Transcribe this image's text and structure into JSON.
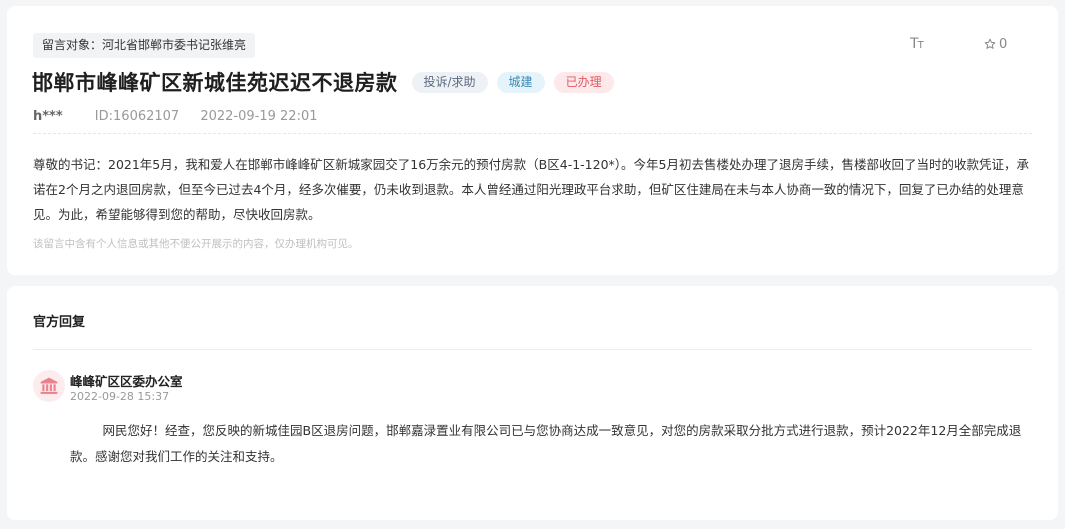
{
  "message": {
    "target_label": "留言对象：河北省邯郸市委书记张维亮",
    "title": "邯郸市峰峰矿区新城佳苑迟迟不退房款",
    "tags": {
      "type": "投诉/求助",
      "category": "城建",
      "status": "已办理"
    },
    "user": "h***",
    "id_label": "ID:16062107",
    "datetime": "2022-09-19 22:01",
    "content": "尊敬的书记：2021年5月，我和爱人在邯郸市峰峰矿区新城家园交了16万余元的预付房款（B区4-1-120*）。今年5月初去售楼处办理了退房手续，售楼部收回了当时的收款凭证，承诺在2个月之内退回房款，但至今已过去4个月，经多次催要，仍未收到退款。本人曾经通过阳光理政平台求助，但矿区住建局在未与本人协商一致的情况下，回复了已办结的处理意见。为此，希望能够得到您的帮助，尽快收回房款。",
    "privacy_note": "该留言中含有个人信息或其他不便公开展示的内容，仅办理机构可见。"
  },
  "toolbar": {
    "font_size_icon": "font-size-icon",
    "font_size_label": "TT",
    "favorite_icon": "star-outline-icon",
    "favorite_count": "0"
  },
  "reply": {
    "section_title": "官方回复",
    "org_icon": "government-building-icon",
    "org_name": "峰峰矿区区委办公室",
    "time": "2022-09-28 15:37",
    "content": "网民您好！经查，您反映的新城佳园B区退房问题，邯郸嘉渌置业有限公司已与您协商达成一致意见，对您的房款采取分批方式进行退款，预计2022年12月全部完成退款。感谢您对我们工作的关注和支持。"
  },
  "colors": {
    "page_background": "#f4f5f7",
    "card_background": "#ffffff",
    "tag_status_text": "#e05a66",
    "tag_category_text": "#3a8ab5",
    "avatar_icon": "#e8828c"
  }
}
